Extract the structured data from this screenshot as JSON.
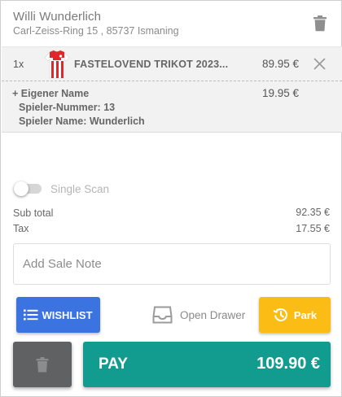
{
  "customer": {
    "name": "Willi Wunderlich",
    "address": "Carl-Zeiss-Ring 15 , 85737 Ismaning"
  },
  "cart": {
    "items": [
      {
        "qty": "1x",
        "name": "FASTELOVEND TRIKOT 2023...",
        "price": "89.95 €",
        "personalization": {
          "title": "+ Eigener Name",
          "price": "19.95 €",
          "player_number": "Spieler-Nummer: 13",
          "player_name": "Spieler Name: Wunderlich"
        }
      }
    ]
  },
  "single_scan": {
    "label": "Single Scan",
    "enabled": false
  },
  "totals": {
    "subtotal_label": "Sub total",
    "subtotal_value": "92.35 €",
    "tax_label": "Tax",
    "tax_value": "17.55 €"
  },
  "sale_note": {
    "placeholder": "Add Sale Note",
    "value": ""
  },
  "actions": {
    "wishlist_label": "WISHLIST",
    "open_drawer_label": "Open Drawer",
    "park_label": "Park",
    "pay_label": "PAY",
    "pay_amount": "109.90 €"
  },
  "colors": {
    "wishlist": "#3b73e0",
    "park": "#fbbd15",
    "pay": "#119c8f",
    "clear": "#5f6162"
  },
  "icons": {
    "header_delete": "trash-icon",
    "remove_item": "close-icon",
    "wishlist": "list-icon",
    "drawer": "drawer-tray-icon",
    "park": "history-clock-icon",
    "clear_cart": "trash-icon"
  }
}
